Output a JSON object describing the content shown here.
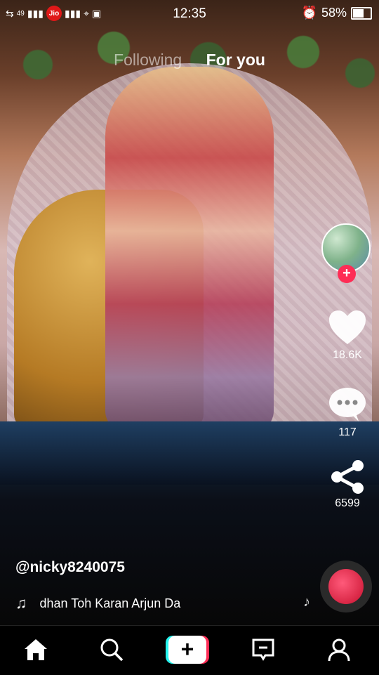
{
  "status_bar": {
    "carrier_badge": "Jio",
    "network_small": "49",
    "time": "12:35",
    "battery": "58%",
    "battery_level": 0.58
  },
  "feed_tabs": {
    "following": "Following",
    "for_you": "For you"
  },
  "actions": {
    "likes": "18.6K",
    "comments": "117",
    "shares": "6599"
  },
  "post": {
    "username": "@nicky8240075",
    "music": "dhan Toh Karan Arjun Da"
  },
  "nav": {
    "items": [
      "home-icon",
      "search-icon",
      "create-icon",
      "inbox-icon",
      "profile-icon"
    ]
  },
  "colors": {
    "accent_red": "#fe2c55",
    "accent_cyan": "#25f4ee"
  }
}
